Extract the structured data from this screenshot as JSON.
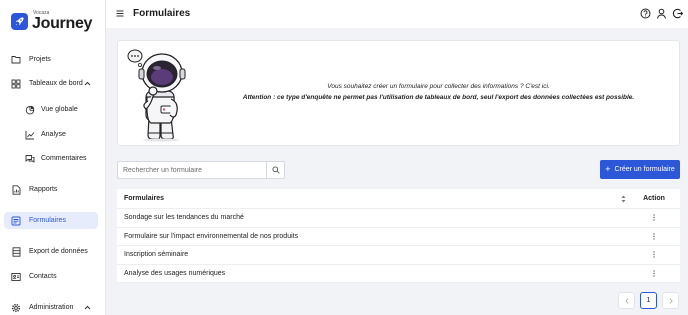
{
  "brand": {
    "small": "Vocaza",
    "name": "Journey",
    "color": "#2c57d9"
  },
  "sidebar": {
    "items": [
      {
        "label": "Projets",
        "icon": "folder-icon"
      },
      {
        "label": "Tableaux de bord",
        "icon": "dashboard-icon",
        "expanded": true
      },
      {
        "label": "Vue globale",
        "icon": "pie-chart-icon"
      },
      {
        "label": "Analyse",
        "icon": "line-chart-icon"
      },
      {
        "label": "Commentaires",
        "icon": "comments-icon"
      },
      {
        "label": "Rapports",
        "icon": "report-icon"
      },
      {
        "label": "Formulaires",
        "icon": "form-icon",
        "active": true
      },
      {
        "label": "Export de données",
        "icon": "export-icon"
      },
      {
        "label": "Contacts",
        "icon": "contacts-icon"
      },
      {
        "label": "Administration",
        "icon": "gear-icon",
        "expanded": true
      }
    ]
  },
  "header": {
    "title": "Formulaires"
  },
  "banner": {
    "line1": "Vous souhaitez créer un formulaire pour collecter des informations ? C'est ici.",
    "line2": "Attention : ce type d'enquête ne permet pas l'utilisation de tableaux de bord, seul l'export des données collectées est possible."
  },
  "search": {
    "placeholder": "Rechercher un formulaire",
    "value": ""
  },
  "create_button": {
    "label": "Créer un formulaire"
  },
  "table": {
    "headers": {
      "name": "Formulaires",
      "action": "Action"
    },
    "rows": [
      {
        "name": "Sondage sur les tendances du marché"
      },
      {
        "name": "Formulaire sur l'impact environnemental de nos produits"
      },
      {
        "name": "Inscription séminaire"
      },
      {
        "name": "Analyse des usages numériques"
      }
    ]
  },
  "pagination": {
    "current": "1"
  }
}
